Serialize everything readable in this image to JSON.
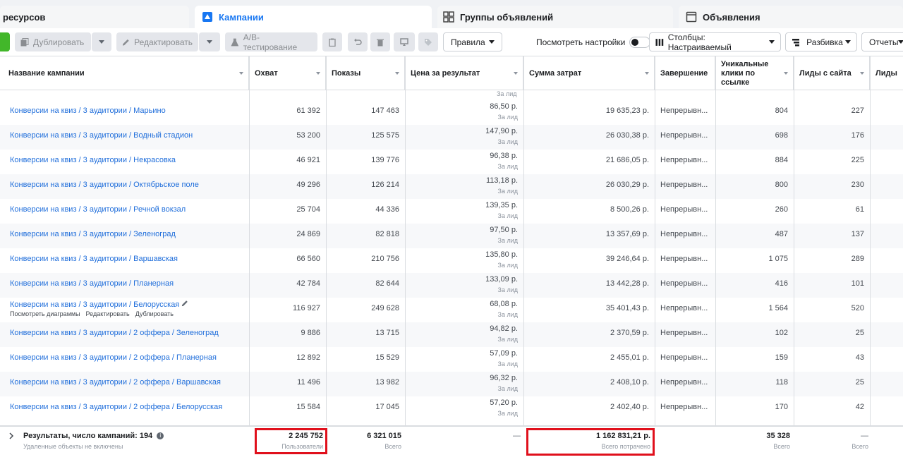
{
  "tabs": [
    {
      "label": "ресурсов"
    },
    {
      "label": "Кампании"
    },
    {
      "label": "Группы объявлений"
    },
    {
      "label": "Объявления"
    }
  ],
  "toolbar": {
    "duplicate": "Дублировать",
    "edit": "Редактировать",
    "ab_test": "A/B-тестирование",
    "rules": "Правила",
    "view_settings": "Посмотреть настройки",
    "columns": "Столбцы: Настраиваемый",
    "breakdown": "Разбивка",
    "reports": "Отчеты"
  },
  "columns": {
    "name": "Название кампании",
    "reach": "Охват",
    "impressions": "Показы",
    "cost_per_result": "Цена за результат",
    "spent": "Сумма затрат",
    "ends": "Завершение",
    "unique_clicks": "Уникальные клики по ссылке",
    "leads_site": "Лиды с сайта",
    "leads": "Лиды"
  },
  "top_partial_sub": "За лид",
  "rows": [
    {
      "name": "Конверсии на квиз / 3 аудитории / Марьино",
      "reach": "61 392",
      "impressions": "147 463",
      "cpr": "86,50 р.",
      "cpr_sub": "За лид",
      "spent": "19 635,23 р.",
      "ends": "Непрерывн...",
      "clicks": "804",
      "leads": "227"
    },
    {
      "name": "Конверсии на квиз / 3 аудитории / Водный стадион",
      "reach": "53 200",
      "impressions": "125 575",
      "cpr": "147,90 р.",
      "cpr_sub": "За лид",
      "spent": "26 030,38 р.",
      "ends": "Непрерывн...",
      "clicks": "698",
      "leads": "176"
    },
    {
      "name": "Конверсии на квиз / 3 аудитории / Некрасовка",
      "reach": "46 921",
      "impressions": "139 776",
      "cpr": "96,38 р.",
      "cpr_sub": "За лид",
      "spent": "21 686,05 р.",
      "ends": "Непрерывн...",
      "clicks": "884",
      "leads": "225"
    },
    {
      "name": "Конверсии на квиз / 3 аудитории / Октябрьское поле",
      "reach": "49 296",
      "impressions": "126 214",
      "cpr": "113,18 р.",
      "cpr_sub": "За лид",
      "spent": "26 030,29 р.",
      "ends": "Непрерывн...",
      "clicks": "800",
      "leads": "230"
    },
    {
      "name": "Конверсии на квиз / 3 аудитории / Речной вокзал",
      "reach": "25 704",
      "impressions": "44 336",
      "cpr": "139,35 р.",
      "cpr_sub": "За лид",
      "spent": "8 500,26 р.",
      "ends": "Непрерывн...",
      "clicks": "260",
      "leads": "61"
    },
    {
      "name": "Конверсии на квиз / 3 аудитории / Зеленоград",
      "reach": "24 869",
      "impressions": "82 818",
      "cpr": "97,50 р.",
      "cpr_sub": "За лид",
      "spent": "13 357,69 р.",
      "ends": "Непрерывн...",
      "clicks": "487",
      "leads": "137"
    },
    {
      "name": "Конверсии на квиз / 3 аудитории / Варшавская",
      "reach": "66 560",
      "impressions": "210 756",
      "cpr": "135,80 р.",
      "cpr_sub": "За лид",
      "spent": "39 246,64 р.",
      "ends": "Непрерывн...",
      "clicks": "1 075",
      "leads": "289"
    },
    {
      "name": "Конверсии на квиз / 3 аудитории / Планерная",
      "reach": "42 784",
      "impressions": "82 644",
      "cpr": "133,09 р.",
      "cpr_sub": "За лид",
      "spent": "13 442,28 р.",
      "ends": "Непрерывн...",
      "clicks": "416",
      "leads": "101"
    },
    {
      "name": "Конверсии на квиз / 3 аудитории / Белорусская",
      "reach": "116 927",
      "impressions": "249 628",
      "cpr": "68,08 р.",
      "cpr_sub": "За лид",
      "spent": "35 401,43 р.",
      "ends": "Непрерывн...",
      "clicks": "1 564",
      "leads": "520",
      "hover": true
    },
    {
      "name": "Конверсии на квиз / 3 аудитории / 2 оффера / Зеленоград",
      "reach": "9 886",
      "impressions": "13 715",
      "cpr": "94,82 р.",
      "cpr_sub": "За лид",
      "spent": "2 370,59 р.",
      "ends": "Непрерывн...",
      "clicks": "102",
      "leads": "25"
    },
    {
      "name": "Конверсии на квиз / 3 аудитории / 2 оффера / Планерная",
      "reach": "12 892",
      "impressions": "15 529",
      "cpr": "57,09 р.",
      "cpr_sub": "За лид",
      "spent": "2 455,01 р.",
      "ends": "Непрерывн...",
      "clicks": "159",
      "leads": "43"
    },
    {
      "name": "Конверсии на квиз / 3 аудитории / 2 оффера / Варшавская",
      "reach": "11 496",
      "impressions": "13 982",
      "cpr": "96,32 р.",
      "cpr_sub": "За лид",
      "spent": "2 408,10 р.",
      "ends": "Непрерывн...",
      "clicks": "118",
      "leads": "25"
    },
    {
      "name": "Конверсии на квиз / 3 аудитории / 2 оффера / Белорусская",
      "reach": "15 584",
      "impressions": "17 045",
      "cpr": "57,20 р.",
      "cpr_sub": "За лид",
      "spent": "2 402,40 р.",
      "ends": "Непрерывн...",
      "clicks": "170",
      "leads": "42"
    }
  ],
  "row_actions": {
    "charts": "Посмотреть диаграммы",
    "edit": "Редактировать",
    "duplicate": "Дублировать"
  },
  "footer": {
    "title": "Результаты, число кампаний: 194",
    "subtitle": "Удаленные объекты не включены",
    "reach": "2 245 752",
    "reach_sub": "Пользователи",
    "impressions": "6 321 015",
    "impressions_sub": "Всего",
    "cpr": "—",
    "spent": "1 162 831,21 р.",
    "spent_sub": "Всего потрачено",
    "clicks": "35 328",
    "clicks_sub": "Всего",
    "leads": "—",
    "leads_sub": "Всего"
  },
  "colors": {
    "accent": "#1877f2",
    "link": "#216fdb",
    "highlight": "#e0101c",
    "create": "#42b72a"
  }
}
